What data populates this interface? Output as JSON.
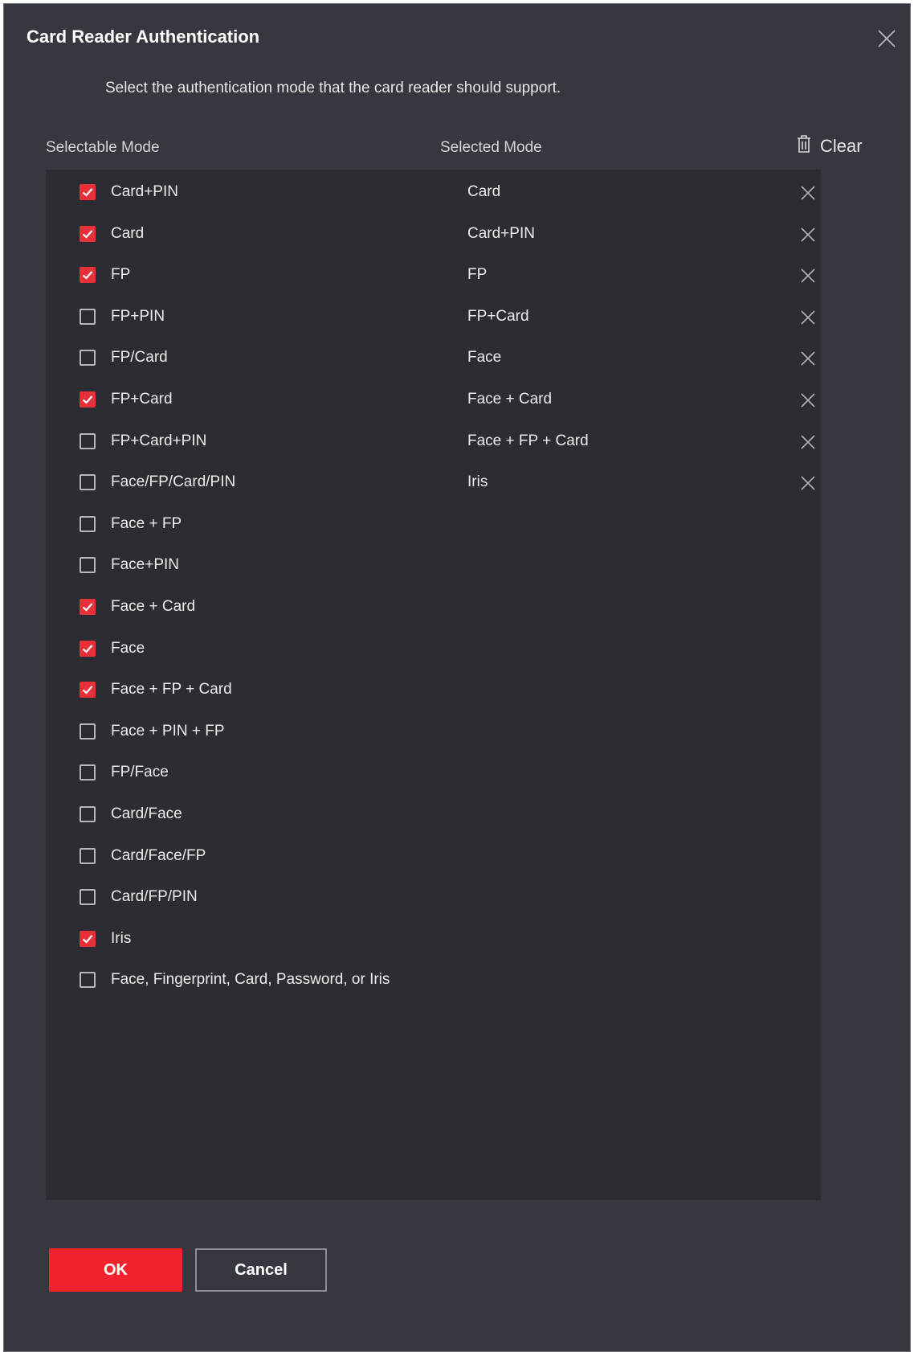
{
  "dialog": {
    "title": "Card Reader Authentication",
    "subtitle": "Select the authentication mode that the card reader should support.",
    "close_icon": "close-icon"
  },
  "selectable": {
    "label": "Selectable Mode",
    "items": [
      {
        "label": "Card+PIN",
        "checked": true
      },
      {
        "label": "Card",
        "checked": true
      },
      {
        "label": "FP",
        "checked": true
      },
      {
        "label": "FP+PIN",
        "checked": false
      },
      {
        "label": "FP/Card",
        "checked": false
      },
      {
        "label": "FP+Card",
        "checked": true
      },
      {
        "label": "FP+Card+PIN",
        "checked": false
      },
      {
        "label": "Face/FP/Card/PIN",
        "checked": false
      },
      {
        "label": "Face + FP",
        "checked": false
      },
      {
        "label": "Face+PIN",
        "checked": false
      },
      {
        "label": "Face + Card",
        "checked": true
      },
      {
        "label": "Face",
        "checked": true
      },
      {
        "label": "Face + FP + Card",
        "checked": true
      },
      {
        "label": "Face + PIN + FP",
        "checked": false
      },
      {
        "label": "FP/Face",
        "checked": false
      },
      {
        "label": "Card/Face",
        "checked": false
      },
      {
        "label": "Card/Face/FP",
        "checked": false
      },
      {
        "label": "Card/FP/PIN",
        "checked": false
      },
      {
        "label": "Iris",
        "checked": true
      },
      {
        "label": "Face, Fingerprint, Card, Password, or Iris",
        "checked": false
      }
    ]
  },
  "selected": {
    "label": "Selected Mode",
    "clear_label": "Clear",
    "items": [
      "Card",
      "Card+PIN",
      "FP",
      "FP+Card",
      "Face",
      "Face + Card",
      "Face + FP + Card",
      "Iris"
    ]
  },
  "buttons": {
    "ok_label": "OK",
    "cancel_label": "Cancel"
  },
  "colors": {
    "accent": "#f2222f",
    "checkbox_checked": "#e8303a",
    "dialog_bg": "#35383e",
    "panel_bg": "#2b2d32"
  }
}
